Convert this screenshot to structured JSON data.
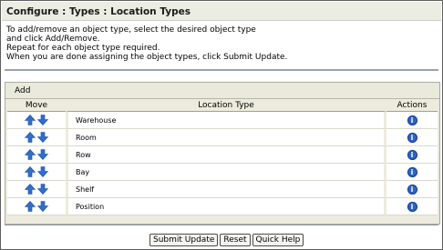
{
  "header": {
    "title": "Configure : Types : Location Types"
  },
  "instructions": [
    "To add/remove an object type, select the desired object type",
    "and click Add/Remove.",
    "Repeat for each object type required.",
    "When you are done assigning the object types, click Submit Update."
  ],
  "panel": {
    "add_label": "Add",
    "columns": {
      "move": "Move",
      "location_type": "Location Type",
      "actions": "Actions"
    },
    "rows": [
      {
        "name": "Warehouse"
      },
      {
        "name": "Room"
      },
      {
        "name": "Row"
      },
      {
        "name": "Bay"
      },
      {
        "name": "Shelf"
      },
      {
        "name": "Position"
      }
    ],
    "icons": {
      "move_up": "arrow-up-icon",
      "move_down": "arrow-down-icon",
      "action": "info-icon"
    },
    "colors": {
      "arrow": "#2f6fd0",
      "info": "#2c63c7"
    }
  },
  "buttons": {
    "submit_update": "Submit Update",
    "reset": "Reset",
    "quick_help": "Quick Help"
  }
}
